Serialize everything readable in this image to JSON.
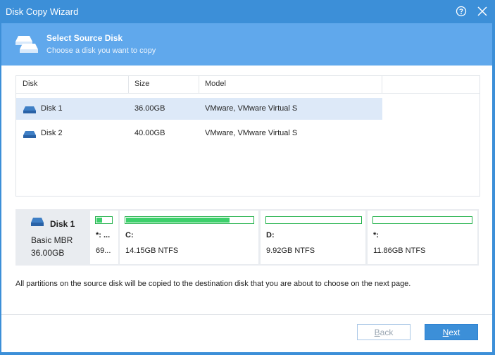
{
  "window": {
    "title": "Disk Copy Wizard"
  },
  "header": {
    "title": "Select Source Disk",
    "subtitle": "Choose a disk you want to copy"
  },
  "table": {
    "columns": [
      "Disk",
      "Size",
      "Model"
    ],
    "rows": [
      {
        "disk": "Disk 1",
        "size": "36.00GB",
        "model": "VMware, VMware Virtual S",
        "selected": true
      },
      {
        "disk": "Disk 2",
        "size": "40.00GB",
        "model": "VMware, VMware Virtual S",
        "selected": false
      }
    ]
  },
  "disk_map": {
    "name": "Disk 1",
    "type": "Basic MBR",
    "size": "36.00GB",
    "partitions": [
      {
        "label": "*: ...",
        "info": "69...",
        "used_fraction": 0.45
      },
      {
        "label": "C:",
        "info": "14.15GB NTFS",
        "used_fraction": 0.82
      },
      {
        "label": "D:",
        "info": "9.92GB NTFS",
        "used_fraction": 0.0
      },
      {
        "label": "*:",
        "info": "11.86GB NTFS",
        "used_fraction": 0.0
      }
    ]
  },
  "note": "All partitions on the source disk will be copied to the destination disk that you are about to choose on the next page.",
  "buttons": {
    "back": "Back",
    "next": "Next"
  },
  "colors": {
    "titlebar": "#3c8fd8",
    "header": "#60a8ec",
    "selected_row": "#dde9f8",
    "partition_fill": "#3dd06b",
    "partition_border": "#23b24b"
  },
  "icons": {
    "help": "help-circle-icon",
    "close": "close-icon",
    "disk": "hard-disk-icon"
  }
}
